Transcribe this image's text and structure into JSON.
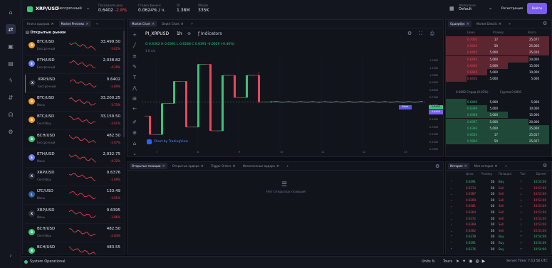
{
  "header": {
    "pair": "XRP/USD",
    "exchange": "Бессрочный",
    "stats": [
      {
        "label": "Последняя цена",
        "value": "0.6402",
        "change": "-2.8%"
      },
      {
        "label": "Ставка финанс.",
        "value": "0.0624%",
        "suffix": "/ ч."
      },
      {
        "label": "OI",
        "value": "1.38M"
      },
      {
        "label": "Объём",
        "value": "335K"
      }
    ],
    "workspace_label": "Workspaces",
    "workspace_value": "Default",
    "register_label": "Регистрация",
    "login_label": "Войти"
  },
  "markets": {
    "tabs": [
      "Книга ордеров",
      "Market Previews"
    ],
    "title": "Открытые рынки",
    "items": [
      {
        "pair": "BTC/USD",
        "exchange": "Бессрочный",
        "price": "33,499.50",
        "change": "-3.62%",
        "dir": "down",
        "coin": "B",
        "color": "#f29c1f"
      },
      {
        "pair": "ETH/USD",
        "exchange": "Бессрочный",
        "price": "2,038.82",
        "change": "-4.29%",
        "dir": "down",
        "coin": "E",
        "color": "#6e7ff3"
      },
      {
        "pair": "XRP/USD",
        "exchange": "Бессрочный",
        "price": "0.6402",
        "change": "-2.80%",
        "dir": "down",
        "coin": "X",
        "color": "#2a2e3f"
      },
      {
        "pair": "BTC/USD",
        "exchange": "Июнь",
        "price": "33,200.25",
        "change": "-3.75%",
        "dir": "down",
        "coin": "B",
        "color": "#f29c1f"
      },
      {
        "pair": "BTC/USD",
        "exchange": "Сентябрь",
        "price": "33,159.50",
        "change": "-3.61%",
        "dir": "down",
        "coin": "B",
        "color": "#f29c1f"
      },
      {
        "pair": "BCH/USD",
        "exchange": "Бессрочный",
        "price": "482.50",
        "change": "-3.07%",
        "dir": "down",
        "coin": "B",
        "color": "#3ec27a"
      },
      {
        "pair": "ETH/USD",
        "exchange": "Июнь",
        "price": "2,032.75",
        "change": "-4.32%",
        "dir": "down",
        "coin": "E",
        "color": "#6e7ff3"
      },
      {
        "pair": "XRP/USD",
        "exchange": "Сентябрь",
        "price": "0.6376",
        "change": "-1.69%",
        "dir": "down",
        "coin": "X",
        "color": "#2a2e3f"
      },
      {
        "pair": "LTC/USD",
        "exchange": "Июнь",
        "price": "133.49",
        "change": "-3.91%",
        "dir": "down",
        "coin": "L",
        "color": "#345d9d"
      },
      {
        "pair": "XRP/USD",
        "exchange": "Июнь",
        "price": "0.6395",
        "change": "-3.86%",
        "dir": "down",
        "coin": "X",
        "color": "#2a2e3f"
      },
      {
        "pair": "BCH/USD",
        "exchange": "Сентябрь",
        "price": "482.50",
        "change": "-2.83%",
        "dir": "down",
        "coin": "B",
        "color": "#3ec27a"
      },
      {
        "pair": "BCH/USD",
        "exchange": "",
        "price": "483.55",
        "change": "",
        "dir": "down",
        "coin": "B",
        "color": "#3ec27a"
      }
    ]
  },
  "chart_panel": {
    "tabs": [
      "Market Chart",
      "Depth Chart"
    ],
    "symbol": "PI_XRPUSD",
    "interval": "1h",
    "indicators_label": "Indicators",
    "ohlc": "O 0.6362  H 0.6391  L 0.6248  C 0.6391  -0.0029 (-0.46%)",
    "volume_label": "1.0",
    "volume_value": "n/a",
    "attribution": "Chart by TradingView",
    "price_tag": "0.6402",
    "mark_label": "Mark",
    "mark_value": "0.6400"
  },
  "chart_data": {
    "type": "candlestick",
    "y_ticks": [
      "1.2000",
      "1.1000",
      "1.0000",
      "0.9000",
      "0.8000",
      "0.7000",
      "0.6000",
      "0.5000",
      "0.4000",
      "0.3000",
      "0.2000",
      "0.1000",
      "0.0000"
    ],
    "x_ticks": [
      "7",
      "8",
      "9",
      "10",
      "11",
      "12",
      "13"
    ],
    "ylim": [
      0,
      1.25
    ],
    "candles": [
      {
        "o": 0.45,
        "c": 0.2,
        "h": 0.45,
        "l": 0.2
      },
      {
        "o": 0.2,
        "c": 0.62,
        "h": 0.62,
        "l": 0.2
      },
      {
        "o": 0.62,
        "c": 0.92,
        "h": 0.92,
        "l": 0.62
      },
      {
        "o": 0.92,
        "c": 0.3,
        "h": 0.92,
        "l": 0.3
      },
      {
        "o": 0.3,
        "c": 1.15,
        "h": 1.15,
        "l": 0.3
      },
      {
        "o": 1.15,
        "c": 0.25,
        "h": 1.15,
        "l": 0.25
      },
      {
        "o": 0.25,
        "c": 1.0,
        "h": 1.0,
        "l": 0.25
      },
      {
        "o": 1.0,
        "c": 0.7,
        "h": 1.0,
        "l": 0.7
      },
      {
        "o": 0.7,
        "c": 1.0,
        "h": 1.0,
        "l": 0.7
      },
      {
        "o": 1.0,
        "c": 0.64,
        "h": 1.05,
        "l": 0.62
      },
      {
        "o": 0.64,
        "c": 0.645,
        "h": 0.65,
        "l": 0.63
      }
    ]
  },
  "orderbook": {
    "tabs": [
      "Ордербук",
      "Market Details"
    ],
    "headers": [
      "Цена",
      "Размер",
      "Всего"
    ],
    "asks": [
      [
        "0.7000",
        "17",
        "25,077"
      ],
      [
        "0.6500",
        "50",
        "25,060"
      ],
      [
        "0.6450",
        "5,000",
        "25,010"
      ],
      [
        "0.6440",
        "5,000",
        "20,000"
      ],
      [
        "0.6430",
        "5,000",
        "15,000"
      ],
      [
        "0.6420",
        "5,000",
        "10,000"
      ],
      [
        "0.6410",
        "5,000",
        "5,000"
      ]
    ],
    "spread_label": "0.0002 Спред (0.03%)",
    "step_label": "Группа 0.0001",
    "bids": [
      [
        "0.6400",
        "5,000",
        "5,000"
      ],
      [
        "0.6399",
        "5,000",
        "10,000"
      ],
      [
        "0.6398",
        "5,000",
        "15,000"
      ],
      [
        "0.6397",
        "5,000",
        "20,000"
      ],
      [
        "0.6396",
        "5,000",
        "25,000"
      ],
      [
        "0.6050",
        "17",
        "25,017"
      ],
      [
        "0.5900",
        "50",
        "25,027"
      ]
    ]
  },
  "trades": {
    "tabs": [
      "История",
      "Моя история"
    ],
    "headers": [
      "Цена",
      "Размер",
      "Позиция",
      "Тип",
      "Время"
    ],
    "rows": [
      [
        "0.6391",
        "10",
        "Buy",
        "10:53:00",
        "up"
      ],
      [
        "0.6374",
        "10",
        "Sell",
        "10:53:00",
        "down"
      ],
      [
        "0.6387",
        "10",
        "Sell",
        "10:53:00",
        "down"
      ],
      [
        "0.6369",
        "10",
        "Sell",
        "10:53:00",
        "down"
      ],
      [
        "0.6381",
        "10",
        "Sell",
        "10:53:00",
        "down"
      ],
      [
        "0.6364",
        "10",
        "Sell",
        "10:53:00",
        "down"
      ],
      [
        "0.6372",
        "10",
        "Sell",
        "10:53:00",
        "down"
      ],
      [
        "0.6369",
        "10",
        "Sell",
        "10:53:00",
        "down"
      ],
      [
        "0.6362",
        "10",
        "Sell",
        "10:53:00",
        "down"
      ],
      [
        "0.6378",
        "10",
        "Buy",
        "10:54:00",
        "up"
      ],
      [
        "0.6391",
        "10",
        "Buy",
        "10:54:00",
        "up"
      ],
      [
        "0.6376",
        "10",
        "Buy",
        "10:54:00",
        "up"
      ]
    ]
  },
  "positions": {
    "tabs": [
      "Открытые позиции",
      "Открытые ордера",
      "Trigger Orders",
      "Исполненные ордера"
    ],
    "empty": "Нет открытых позиций"
  },
  "footer": {
    "status": "System Operational",
    "units_label": "Units",
    "tours_label": "Tours",
    "server_time": "Server Time: 7:13:56 UTC"
  }
}
